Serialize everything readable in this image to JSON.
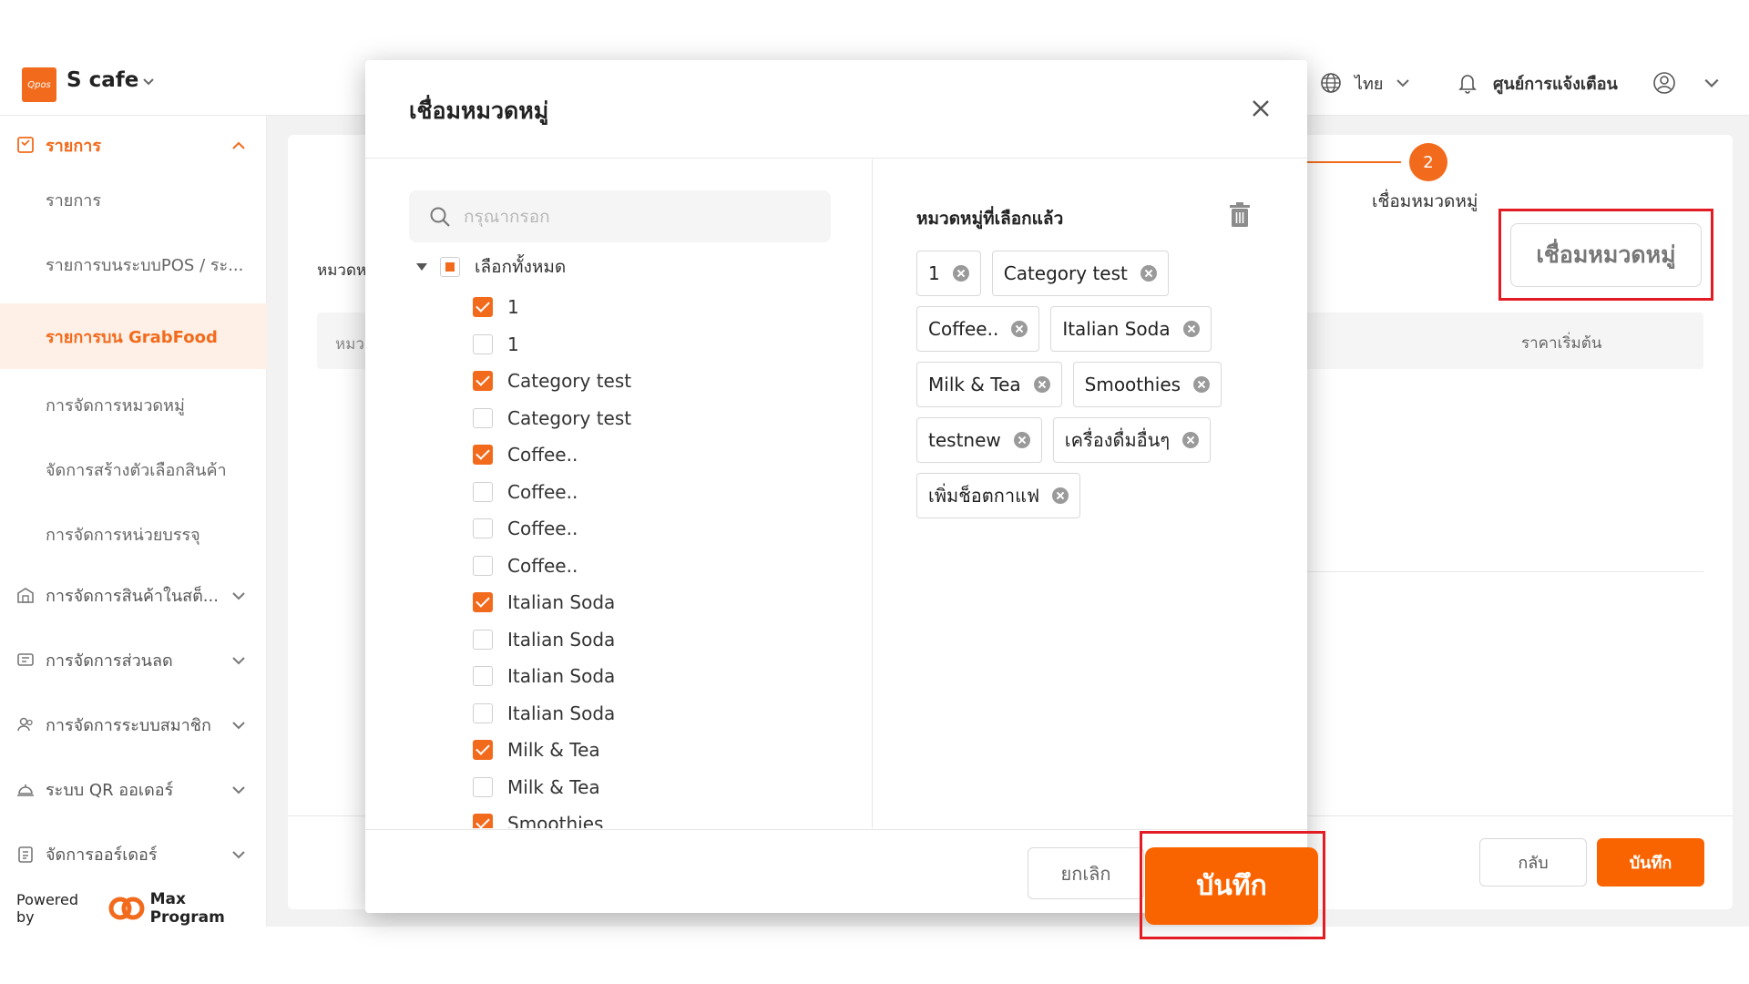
{
  "app": {
    "brand_logo": "Qpos",
    "brand_name": "S cafe",
    "language": "ไทย",
    "notifications": "ศูนย์การแจ้งเตือน"
  },
  "sidebar": {
    "main_group": "รายการ",
    "items": [
      "รายการ",
      "รายการบนระบบPOS / ระ...",
      "รายการบน GrabFood",
      "การจัดการหมวดหมู่",
      "จัดการสร้างตัวเลือกสินค้า",
      "การจัดการหน่วยบรรจุ"
    ],
    "groups": [
      "การจัดการสินค้าในสต็...",
      "การจัดการส่วนลด",
      "การจัดการระบบสมาชิก",
      "ระบบ QR ออเดอร์",
      "จัดการออร์เดอร์"
    ],
    "powered_by": "Powered by",
    "powered_brand": "Max Program"
  },
  "background": {
    "step_number": "2",
    "step_label": "เชื่อมหมวดหมู่",
    "link_button": "เชื่อมหมวดหมู่",
    "label_left": "หมวดห",
    "header_left": "หมว",
    "column_price": "ราคาเริ่มต้น",
    "back_button": "กลับ",
    "save_button": "บันทึก"
  },
  "modal": {
    "title": "เชื่อมหมวดหมู่",
    "search_placeholder": "กรุณากรอก",
    "select_all": "เลือกทั้งหมด",
    "tree": [
      {
        "label": "1",
        "checked": true
      },
      {
        "label": "1",
        "checked": false
      },
      {
        "label": "Category test",
        "checked": true
      },
      {
        "label": "Category test",
        "checked": false
      },
      {
        "label": "Coffee..",
        "checked": true
      },
      {
        "label": "Coffee..",
        "checked": false
      },
      {
        "label": "Coffee..",
        "checked": false
      },
      {
        "label": "Coffee..",
        "checked": false
      },
      {
        "label": "Italian Soda",
        "checked": true
      },
      {
        "label": "Italian Soda",
        "checked": false
      },
      {
        "label": "Italian Soda",
        "checked": false
      },
      {
        "label": "Italian Soda",
        "checked": false
      },
      {
        "label": "Milk & Tea",
        "checked": true
      },
      {
        "label": "Milk & Tea",
        "checked": false
      },
      {
        "label": "Smoothies",
        "checked": true
      }
    ],
    "selected_title": "หมวดหมู่ที่เลือกแล้ว",
    "selected_tags": [
      "1",
      "Category test",
      "Coffee..",
      "Italian Soda",
      "Milk & Tea",
      "Smoothies",
      "testnew",
      "เครื่องดื่มอื่นๆ",
      "เพิ่มช็อตกาแฟ"
    ],
    "cancel_button": "ยกเลิก",
    "save_button": "บันทึก"
  },
  "colors": {
    "accent": "#f26b1d",
    "highlight_box": "#e31b23"
  }
}
